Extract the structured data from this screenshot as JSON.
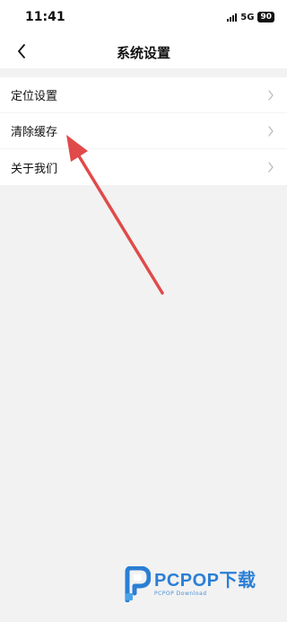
{
  "status_bar": {
    "time": "11:41",
    "network": "5G",
    "battery": "90"
  },
  "nav": {
    "title": "系统设置",
    "back_icon": "chevron-left-icon"
  },
  "menu": {
    "items": [
      {
        "label": "定位设置",
        "icon": "chevron-right-icon"
      },
      {
        "label": "清除缓存",
        "icon": "chevron-right-icon"
      },
      {
        "label": "关于我们",
        "icon": "chevron-right-icon"
      }
    ]
  },
  "annotation": {
    "arrow_color": "#e04a4a"
  },
  "watermark": {
    "logo_text": "PCPOP下载",
    "sub_text": "PCPOP Download",
    "color": "#2a7fd4"
  }
}
